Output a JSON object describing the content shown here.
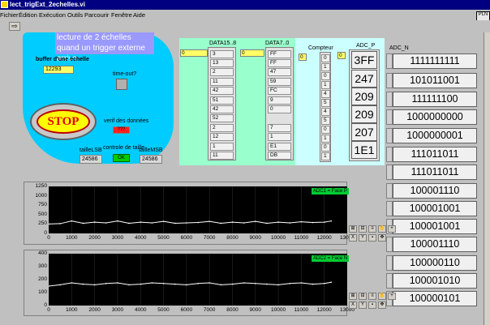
{
  "window": {
    "title": "lect_trigExt_2echelles.vi"
  },
  "menu": [
    "Fichier",
    "Édition",
    "Exécution",
    "Outils",
    "Parcourir",
    "Fenêtre",
    "Aide"
  ],
  "toolbar": {
    "run_glyph": "⇨"
  },
  "logo": {
    "text": "PLN"
  },
  "panel": {
    "description": "lecture de 2 échelles quand un trigger externe arrive",
    "buffer_label": "buffer d'une échelle",
    "buffer_value": "12293",
    "timeout_label": "time-out?",
    "stop_label": "STOP",
    "verif_label": "verif des données",
    "verif_value": "???",
    "controle_label": "controle de taille",
    "controle_value": "OK",
    "taille_lsb_label": "tailleLSB",
    "taille_lsb_value": "24586",
    "taille_msb_label": "tailleMSB",
    "taille_msb_value": "24586"
  },
  "data15_8": {
    "label": "DATA15..8",
    "index": "0",
    "values": [
      "3",
      "13",
      "2",
      "11",
      "42",
      "51",
      "42",
      "52",
      "2",
      "12",
      "1",
      "11"
    ]
  },
  "data7_0": {
    "label": "DATA7..0",
    "index": "0",
    "values": [
      "FF",
      "FF",
      "47",
      "59",
      "FC",
      "9",
      "0",
      "7",
      "1",
      "E1",
      "DB"
    ]
  },
  "compteur": {
    "label": "Compteur",
    "index": "0",
    "values": [
      "0",
      "1",
      "0",
      "1",
      "4",
      "5",
      "4",
      "5",
      "0",
      "1",
      "0",
      "1"
    ]
  },
  "adc_p": {
    "label": "ADC_P",
    "index": "0",
    "values": [
      "3FF",
      "247",
      "209",
      "209",
      "207",
      "1E1"
    ]
  },
  "adc_n": {
    "label": "ADC_N",
    "values": [
      "1111111111",
      "101011001",
      "111111100",
      "1000000000",
      "1000000001",
      "111011011",
      "111011011",
      "100001110",
      "100001001",
      "100001001",
      "100001110",
      "100000110",
      "100001010",
      "100000101"
    ]
  },
  "chart1": {
    "legend": "ADC1 = Face P",
    "ylim": [
      0,
      1250
    ],
    "yticks": [
      "1250",
      "1000",
      "750",
      "500",
      "250",
      "0"
    ]
  },
  "chart2": {
    "legend": "ADC2 = Face N",
    "ylim": [
      0,
      400
    ],
    "yticks": [
      "400",
      "300",
      "200",
      "100",
      "0"
    ]
  },
  "xticks": [
    "0",
    "1000",
    "2000",
    "3000",
    "4000",
    "5000",
    "6000",
    "7000",
    "8000",
    "9000",
    "10000",
    "11000",
    "12000",
    "13000"
  ],
  "chart_data": [
    {
      "type": "line",
      "title": "",
      "legend": [
        "ADC1 = Face P"
      ],
      "xlim": [
        0,
        13000
      ],
      "ylim": [
        0,
        1250
      ],
      "x": [
        0,
        500,
        1000,
        1500,
        2000,
        2500,
        3000,
        3500,
        4000,
        4500,
        5000,
        5500,
        6000,
        6500,
        7000,
        7500,
        8000,
        8500,
        9000,
        9500,
        10000,
        10500,
        11000,
        11500,
        12000,
        12300
      ],
      "series": [
        {
          "name": "ADC1 = Face P",
          "values": [
            250,
            260,
            330,
            270,
            300,
            280,
            330,
            270,
            300,
            280,
            320,
            270,
            280,
            290,
            320,
            270,
            300,
            280,
            320,
            270,
            300,
            280,
            310,
            290,
            300,
            330
          ]
        }
      ]
    },
    {
      "type": "line",
      "title": "",
      "legend": [
        "ADC2 = Face N"
      ],
      "xlim": [
        0,
        13000
      ],
      "ylim": [
        0,
        400
      ],
      "x": [
        0,
        500,
        1000,
        1500,
        2000,
        2500,
        3000,
        3500,
        4000,
        4500,
        5000,
        5500,
        6000,
        6500,
        7000,
        7500,
        8000,
        8500,
        9000,
        9500,
        10000,
        10500,
        11000,
        11500,
        12000,
        12300
      ],
      "series": [
        {
          "name": "ADC2 = Face N",
          "values": [
            150,
            160,
            175,
            165,
            160,
            170,
            175,
            160,
            165,
            175,
            170,
            165,
            160,
            170,
            175,
            160,
            165,
            175,
            170,
            165,
            160,
            170,
            175,
            165,
            170,
            180
          ]
        }
      ]
    }
  ]
}
